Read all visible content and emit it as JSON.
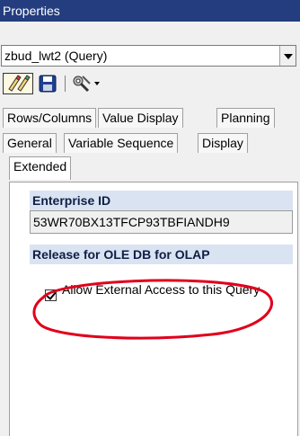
{
  "window": {
    "title": "Properties"
  },
  "object_selector": {
    "value": "zbud_lwt2 (Query)"
  },
  "toolbar": {
    "buttons": [
      {
        "name": "display-mode-icon"
      },
      {
        "name": "save-icon"
      },
      {
        "name": "tools-icon"
      }
    ]
  },
  "tabs": [
    {
      "label": "Rows/Columns"
    },
    {
      "label": "Value Display"
    },
    {
      "label": "Planning"
    },
    {
      "label": "General"
    },
    {
      "label": "Variable Sequence"
    },
    {
      "label": "Display"
    },
    {
      "label": "Extended"
    }
  ],
  "active_tab": "Extended",
  "sections": {
    "enterprise": {
      "heading": "Enterprise ID",
      "value": "53WR70BX13TFCP93TBFIANDH9"
    },
    "release": {
      "heading": "Release for OLE DB for OLAP",
      "checkbox_label": "Allow External Access to this Query",
      "checked": true
    }
  },
  "colors": {
    "titlebar": "#233d7e",
    "section_header": "#d9e3f2",
    "annotation": "#e0001b"
  }
}
